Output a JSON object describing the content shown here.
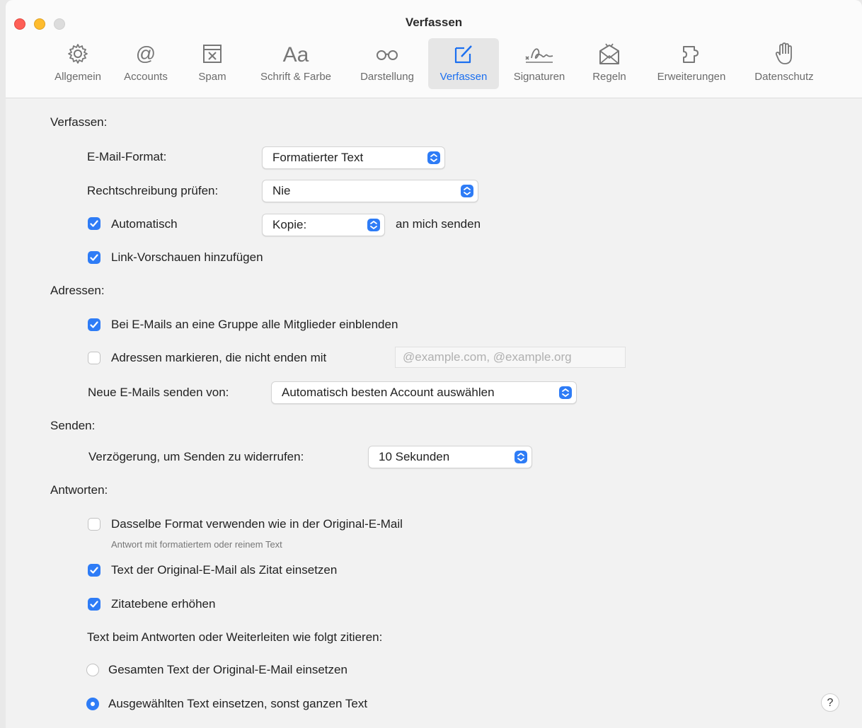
{
  "window": {
    "title": "Verfassen"
  },
  "toolbar": {
    "items": [
      {
        "label": "Allgemein",
        "icon": "gear-icon"
      },
      {
        "label": "Accounts",
        "icon": "at-icon"
      },
      {
        "label": "Spam",
        "icon": "junk-tray-icon"
      },
      {
        "label": "Schrift & Farbe",
        "icon": "font-icon"
      },
      {
        "label": "Darstellung",
        "icon": "glasses-icon"
      },
      {
        "label": "Verfassen",
        "icon": "compose-icon",
        "active": true
      },
      {
        "label": "Signaturen",
        "icon": "signature-icon"
      },
      {
        "label": "Regeln",
        "icon": "rules-envelope-icon"
      },
      {
        "label": "Erweiterungen",
        "icon": "puzzle-icon"
      },
      {
        "label": "Datenschutz",
        "icon": "hand-icon"
      }
    ],
    "font_glyph": "Aa"
  },
  "compose": {
    "heading": "Verfassen:",
    "email_format_label": "E-Mail-Format:",
    "email_format_value": "Formatierter Text",
    "spellcheck_label": "Rechtschreibung prüfen:",
    "spellcheck_value": "Nie",
    "auto_label": "Automatisch",
    "auto_checked": true,
    "auto_copy_value": "Kopie:",
    "auto_suffix": "an mich senden",
    "link_previews_label": "Link-Vorschauen hinzufügen",
    "link_previews_checked": true
  },
  "addresses": {
    "heading": "Adressen:",
    "group_label": "Bei E-Mails an eine Gruppe alle Mitglieder einblenden",
    "group_checked": true,
    "mark_label": "Adressen markieren, die nicht enden mit",
    "mark_checked": false,
    "mark_placeholder": "@example.com, @example.org",
    "send_from_label": "Neue E-Mails senden von:",
    "send_from_value": "Automatisch besten Account auswählen"
  },
  "send": {
    "heading": "Senden:",
    "undo_label": "Verzögerung, um Senden zu widerrufen:",
    "undo_value": "10 Sekunden"
  },
  "reply": {
    "heading": "Antworten:",
    "same_format_label": "Dasselbe Format verwenden wie in der Original-E-Mail",
    "same_format_checked": false,
    "same_format_sub": "Antwort mit formatiertem oder reinem Text",
    "quote_label": "Text der Original-E-Mail als Zitat einsetzen",
    "quote_checked": true,
    "increase_level_label": "Zitatebene erhöhen",
    "increase_level_checked": true,
    "quote_mode_label": "Text beim Antworten oder Weiterleiten wie folgt zitieren:",
    "option_all_label": "Gesamten Text der Original-E-Mail einsetzen",
    "option_selected_label": "Ausgewählten Text einsetzen, sonst ganzen Text",
    "selected_option": "selected"
  },
  "help": {
    "label": "?"
  },
  "colors": {
    "accent": "#2e7cf6",
    "active_tab_text": "#1b6ff0"
  }
}
